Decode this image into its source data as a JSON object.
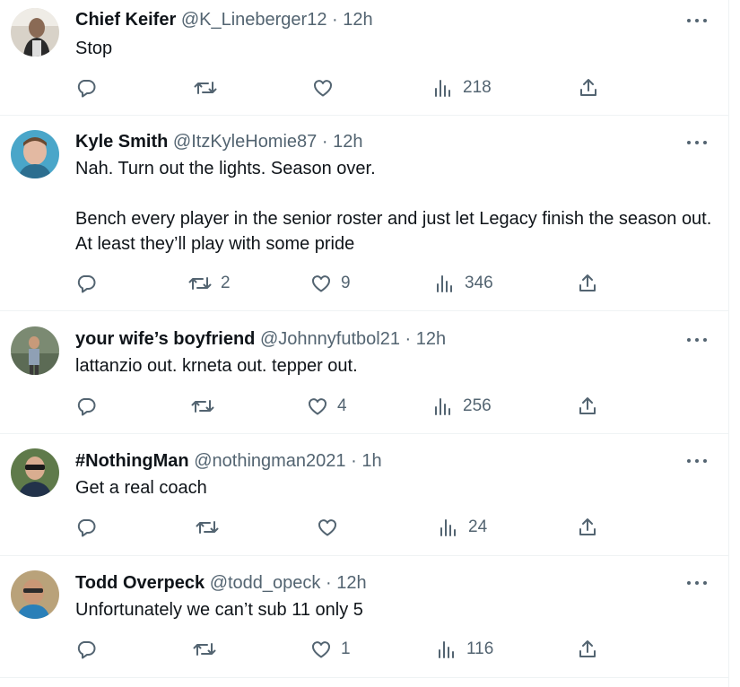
{
  "tweets": [
    {
      "name": "Chief Keifer",
      "handle": "@K_Lineberger12",
      "time": "12h",
      "text": "Stop",
      "replies": "",
      "retweets": "",
      "likes": "",
      "views": "218"
    },
    {
      "name": "Kyle Smith",
      "handle": "@ItzKyleHomie87",
      "time": "12h",
      "text": "Nah. Turn out the lights. Season over.\n\nBench every player in the senior roster and just let Legacy finish the season out. At least they’ll play with some pride",
      "replies": "",
      "retweets": "2",
      "likes": "9",
      "views": "346"
    },
    {
      "name": "your wife’s boyfriend",
      "handle": "@Johnnyfutbol21",
      "time": "12h",
      "text": "lattanzio out. krneta out. tepper out.",
      "replies": "",
      "retweets": "",
      "likes": "4",
      "views": "256"
    },
    {
      "name": "#NothingMan",
      "handle": "@nothingman2021",
      "time": "1h",
      "text": "Get a real coach",
      "replies": "",
      "retweets": "",
      "likes": "",
      "views": "24"
    },
    {
      "name": "Todd Overpeck",
      "handle": "@todd_opeck",
      "time": "12h",
      "text": "Unfortunately we can’t sub 11 only 5",
      "replies": "",
      "retweets": "",
      "likes": "1",
      "views": "116"
    }
  ],
  "separator": "·",
  "icons": {
    "reply": "reply-icon",
    "retweet": "retweet-icon",
    "like": "like-icon",
    "views": "views-icon",
    "share": "share-icon",
    "more": "more-icon"
  },
  "colors": {
    "text": "#0f1419",
    "muted": "#536471",
    "border": "#eff3f4"
  }
}
